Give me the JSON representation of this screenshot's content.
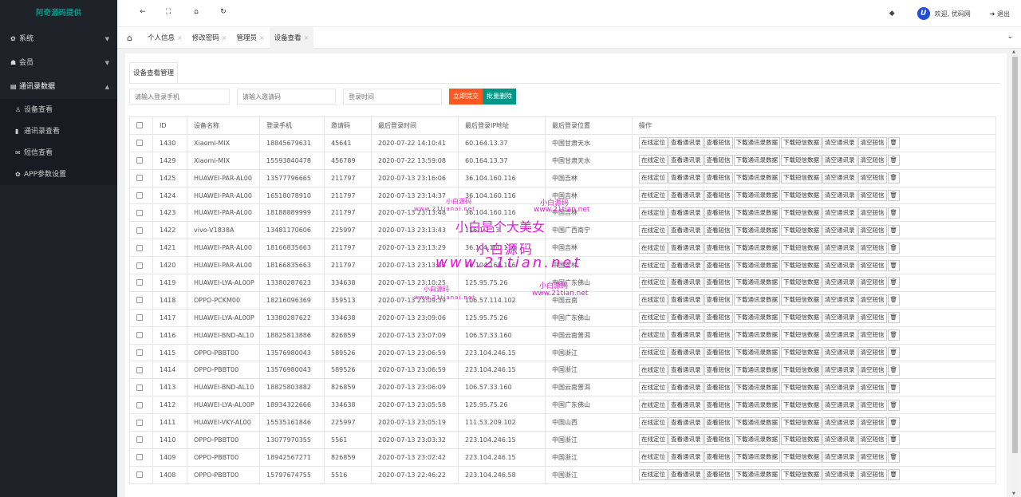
{
  "sidebar": {
    "logo": "阿奇源码提供",
    "menus": [
      {
        "label": "系统"
      },
      {
        "label": "会员"
      },
      {
        "label": "通讯录数据"
      }
    ],
    "submenu": [
      "设备查看",
      "通讯录查看",
      "短信查看",
      "APP参数设置"
    ]
  },
  "header": {
    "welcome": "欢迎, 优码网",
    "logout": "退出",
    "avatar_letter": "U"
  },
  "tabs": [
    "个人信息",
    "修改密码",
    "管理员",
    "设备查看"
  ],
  "panel": {
    "title": "设备查看管理",
    "search": {
      "phone_placeholder": "请输入登录手机",
      "code_placeholder": "请输入邀请码",
      "time_placeholder": "登录时间",
      "submit": "立即提交",
      "batch_delete": "批量删除"
    },
    "columns": [
      "ID",
      "设备名称",
      "登录手机",
      "邀请码",
      "最后登录时间",
      "最后登录IP地址",
      "最后登录位置",
      "操作"
    ],
    "actions": [
      "在线定位",
      "查看通讯录",
      "查看短信",
      "下载通讯录数据",
      "下载短信数据",
      "清空通讯录",
      "清空短信"
    ],
    "rows": [
      [
        "1430",
        "Xiaomi-MIX",
        "18845679631",
        "45641",
        "2020-07-22 14:10:41",
        "60.164.13.37",
        "中国甘肃天水"
      ],
      [
        "1429",
        "Xiaomi-MIX",
        "15593840478",
        "456789",
        "2020-07-22 13:59:08",
        "60.164.13.37",
        "中国甘肃天水"
      ],
      [
        "1425",
        "HUAWEI-PAR-AL00",
        "13577796665",
        "211797",
        "2020-07-13 23:16:06",
        "36.104.160.116",
        "中国吉林"
      ],
      [
        "1424",
        "HUAWEI-PAR-AL00",
        "16518078910",
        "211797",
        "2020-07-13 23:14:37",
        "36.104.160.116",
        "中国吉林"
      ],
      [
        "1423",
        "HUAWEI-PAR-AL00",
        "18188889999",
        "211797",
        "2020-07-13 23:13:48",
        "36.104.160.116",
        "中国吉林"
      ],
      [
        "1422",
        "vivo-V1838A",
        "13481170606",
        "225997",
        "2020-07-13 23:13:43",
        "116.1.1.13",
        "中国广西南宁"
      ],
      [
        "1421",
        "HUAWEI-PAR-AL00",
        "18166835663",
        "211797",
        "2020-07-13 23:13:29",
        "36.104.160.116",
        "中国吉林"
      ],
      [
        "1420",
        "HUAWEI-PAR-AL00",
        "18166835663",
        "211797",
        "2020-07-13 23:13:33",
        "36.104.160.116",
        "中国吉林"
      ],
      [
        "1419",
        "HUAWEI-LYA-AL00P",
        "13380287623",
        "334638",
        "2020-07-13 23:10:25",
        "125.95.75.26",
        "中国广东佛山"
      ],
      [
        "1418",
        "OPPO-PCKM00",
        "18216096369",
        "359513",
        "2020-07-13 23:09:39",
        "106.57.114.102",
        "中国云南"
      ],
      [
        "1417",
        "HUAWEI-LYA-AL00P",
        "13380287622",
        "334638",
        "2020-07-13 23:09:06",
        "125.95.75.26",
        "中国广东佛山"
      ],
      [
        "1416",
        "HUAWEI-BND-AL10",
        "18825813886",
        "826859",
        "2020-07-13 23:07:09",
        "106.57.33.160",
        "中国云南普洱"
      ],
      [
        "1415",
        "OPPO-PBBT00",
        "13576980043",
        "589526",
        "2020-07-13 23:06:59",
        "223.104.246.15",
        "中国浙江"
      ],
      [
        "1414",
        "OPPO-PBBT00",
        "13576980043",
        "589526",
        "2020-07-13 23:06:59",
        "223.104.246.15",
        "中国浙江"
      ],
      [
        "1413",
        "HUAWEI-BND-AL10",
        "18825803882",
        "826859",
        "2020-07-13 23:06:09",
        "106.57.33.160",
        "中国云南普洱"
      ],
      [
        "1412",
        "HUAWEI-LYA-AL00P",
        "18934322666",
        "334638",
        "2020-07-13 23:05:58",
        "125.95.75.26",
        "中国广东佛山"
      ],
      [
        "1411",
        "HUAWEI-VKY-AL00",
        "15535161846",
        "225997",
        "2020-07-13 23:05:19",
        "111.53.209.102",
        "中国山西"
      ],
      [
        "1410",
        "OPPO-PBBT00",
        "13077970355",
        "5561",
        "2020-07-13 23:03:32",
        "223.104.246.15",
        "中国浙江"
      ],
      [
        "1409",
        "OPPO-PBBT00",
        "18942567271",
        "826859",
        "2020-07-13 23:02:42",
        "223.104.246.15",
        "中国浙江"
      ],
      [
        "1408",
        "OPPO-PBBT00",
        "15797674755",
        "5516",
        "2020-07-13 22:46:22",
        "223.104.246.58",
        "中国浙江"
      ]
    ]
  },
  "watermarks": {
    "small_1": "小白源码",
    "small_1_url": "www.21tianai.net",
    "small_2": "小白源码",
    "small_2_url": "www.21tian.net",
    "big_1": "小白是个大美女",
    "big_2": "小白源码",
    "big_3": "www.21tian.net",
    "small_3": "小白源码",
    "small_3_url": "www.21tianai.net",
    "small_4": "小白源码",
    "small_4_url": "www.21tian.net"
  },
  "colors": {
    "sidebar_bg": "#20222a",
    "logo": "#009688",
    "submit": "#ff5722",
    "batch": "#009688",
    "watermark": "#e21ad8"
  }
}
